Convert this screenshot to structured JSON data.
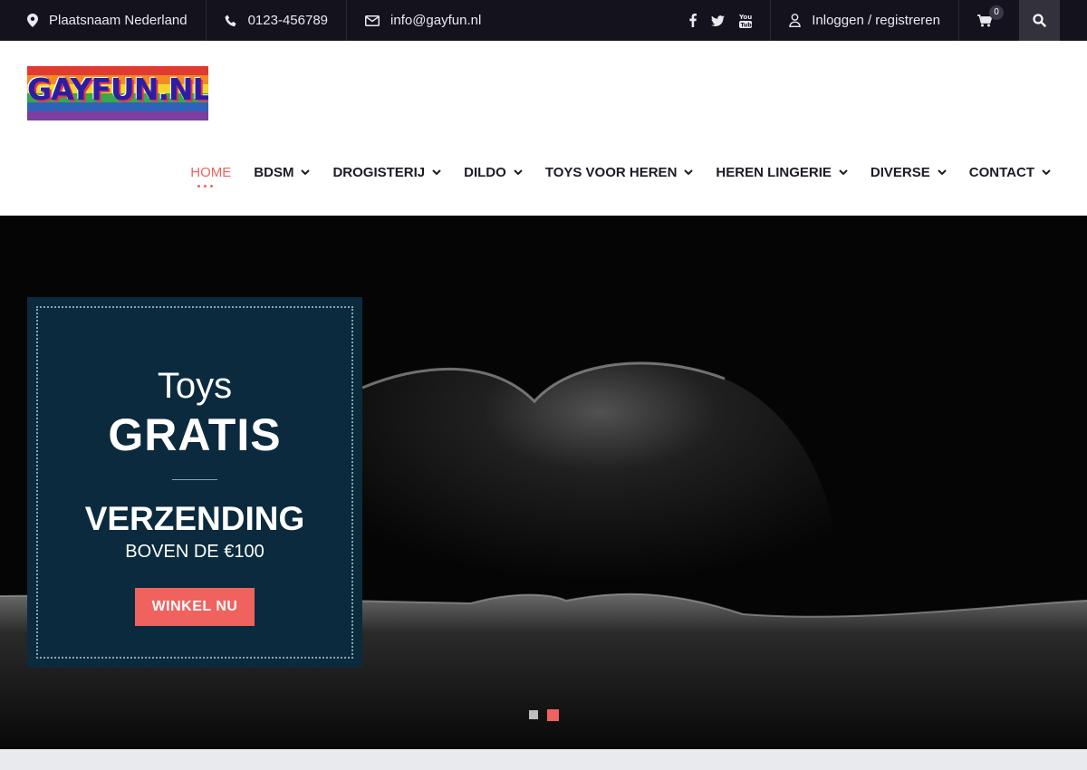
{
  "topbar": {
    "location": "Plaatsnaam Nederland",
    "phone": "0123-456789",
    "email": "info@gayfun.nl",
    "social": [
      "facebook-icon",
      "twitter-icon",
      "youtube-icon"
    ],
    "login": "Inloggen / registreren",
    "cart_count": "0"
  },
  "header": {
    "logo_text": "GAYFUN.NL",
    "logo_colors": [
      "#e23a30",
      "#f08a24",
      "#f4d72a",
      "#3aa64a",
      "#2e63b8",
      "#7b3f9e"
    ]
  },
  "nav": {
    "items": [
      {
        "label": "HOME",
        "active": true
      },
      {
        "label": "BDSM"
      },
      {
        "label": "DROGISTERIJ"
      },
      {
        "label": "DILDO"
      },
      {
        "label": "TOYS VOOR HEREN"
      },
      {
        "label": "HEREN LINGERIE"
      },
      {
        "label": "DIVERSE"
      },
      {
        "label": "CONTACT"
      }
    ]
  },
  "hero": {
    "pre_title": "Toys",
    "title": "GRATIS",
    "subtitle": "VERZENDING",
    "subtitle2": "BOVEN DE €100",
    "button": "WINKEL NU",
    "slides": 2,
    "active_slide": 2
  },
  "colors": {
    "accent": "#f0625e",
    "topbar": "#14121c",
    "promo_bg": "#0b2a3d"
  }
}
